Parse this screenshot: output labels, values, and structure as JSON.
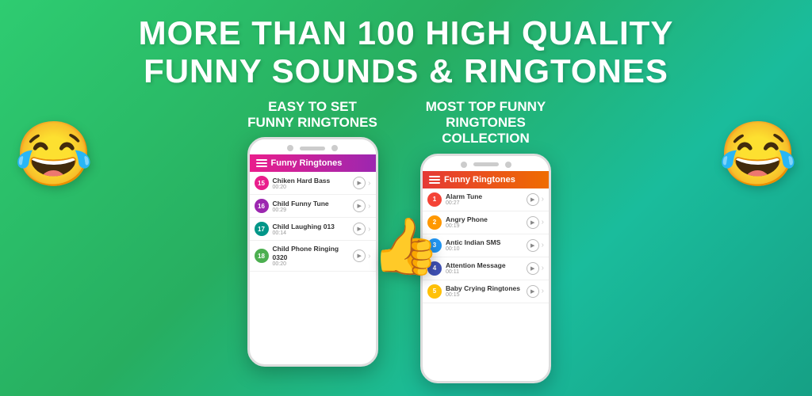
{
  "headline": {
    "line1": "MORE THAN 100 HIGH QUALITY",
    "line2": "FUNNY SOUNDS & RINGTONES"
  },
  "leftPhone": {
    "label": "EASY TO SET\nFUNNY RINGTONES",
    "header": "Funny Ringtones",
    "songs": [
      {
        "num": "15",
        "title": "Chiken Hard Bass",
        "time": "00:20",
        "numClass": "num-pink"
      },
      {
        "num": "16",
        "title": "Child Funny Tune",
        "time": "00:29",
        "numClass": "num-purple"
      },
      {
        "num": "17",
        "title": "Child Laughing 013",
        "time": "00:14",
        "numClass": "num-teal"
      },
      {
        "num": "18",
        "title": "Child Phone Ringing 0320",
        "time": "00:20",
        "numClass": "num-green"
      }
    ]
  },
  "rightPhone": {
    "label": "MOST TOP FUNNY\nRINGTONES COLLECTION",
    "header": "Funny Ringtones",
    "songs": [
      {
        "num": "1",
        "title": "Alarm Tune",
        "time": "00:27",
        "numClass": "num-red"
      },
      {
        "num": "2",
        "title": "Angry Phone",
        "time": "00:19",
        "numClass": "num-orange"
      },
      {
        "num": "3",
        "title": "Antic Indian SMS",
        "time": "00:10",
        "numClass": "num-blue"
      },
      {
        "num": "4",
        "title": "Attention Message",
        "time": "00:11",
        "numClass": "num-indigo"
      },
      {
        "num": "5",
        "title": "Baby Crying Ringtones",
        "time": "00:15",
        "numClass": "num-amber"
      }
    ]
  },
  "emojis": {
    "left": "😂",
    "right": "😂",
    "middle": "👍"
  }
}
